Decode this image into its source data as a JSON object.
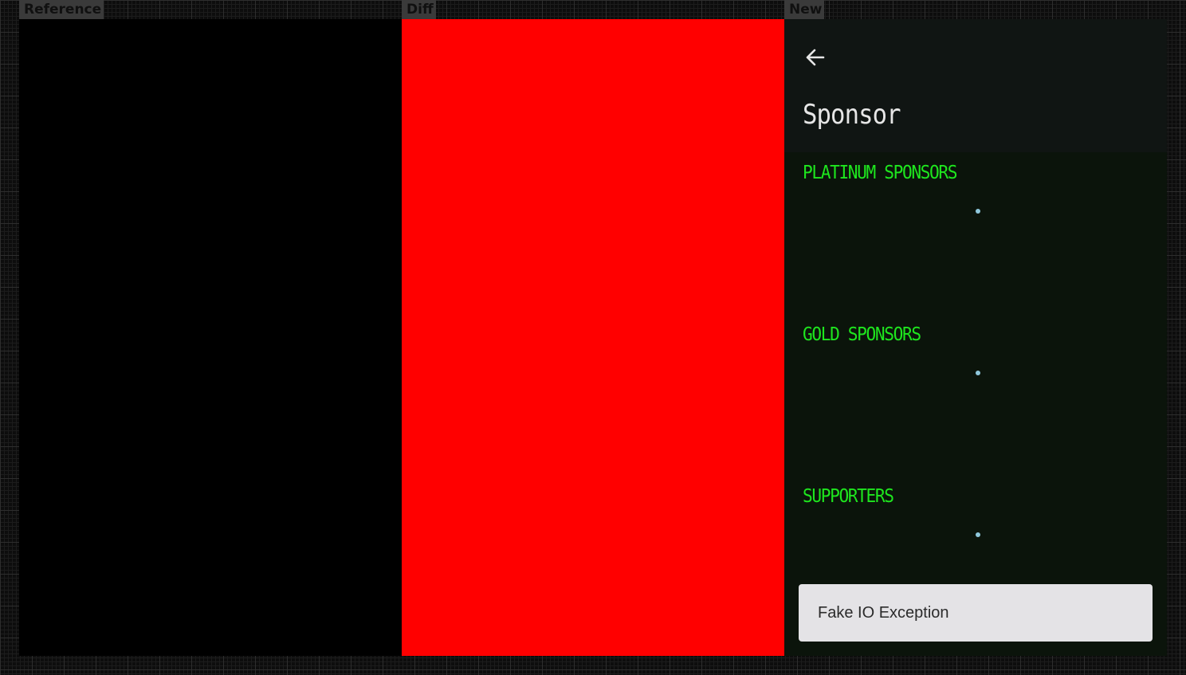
{
  "labels": {
    "reference": "Reference",
    "diff": "Diff",
    "new": "New"
  },
  "app": {
    "title": "Sponsor",
    "back_icon": "arrow-left-icon",
    "sections": [
      {
        "title": "PLATINUM SPONSORS"
      },
      {
        "title": "GOLD SPONSORS"
      },
      {
        "title": "SUPPORTERS"
      }
    ],
    "snackbar": {
      "message": "Fake IO Exception"
    }
  },
  "colors": {
    "reference_bg": "#000000",
    "diff_bg": "#ff0000",
    "app_bar_bg": "#101513",
    "content_bg": "#0b140b",
    "section_title": "#1ee61e",
    "loading_dot": "#8fc8dc",
    "snackbar_bg": "#e4e3e6"
  }
}
